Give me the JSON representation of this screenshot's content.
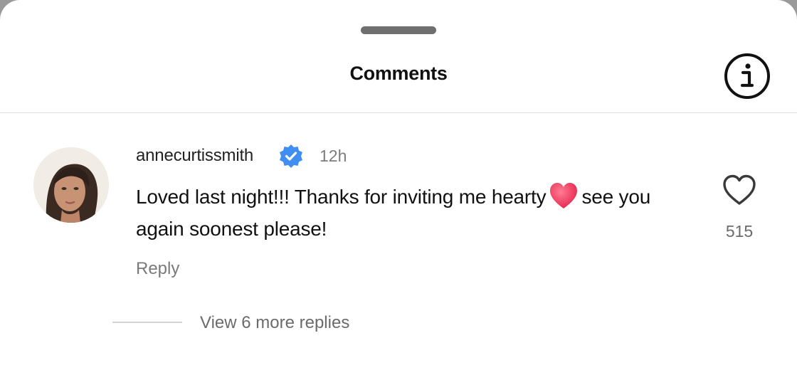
{
  "header": {
    "title": "Comments",
    "info_icon": "info-circle-icon"
  },
  "comment": {
    "username": "annecurtissmith",
    "verified_icon": "verified-badge-icon",
    "timestamp": "12h",
    "text_before_emoji": "Loved last night!!! Thanks for inviting me hearty",
    "emoji": "red-heart-emoji",
    "text_after_emoji": "see you again soonest please!",
    "reply_label": "Reply",
    "like_icon": "heart-outline-icon",
    "like_count": "515"
  },
  "replies": {
    "view_more_label": "View 6 more replies"
  },
  "colors": {
    "verified_blue": "#3f8ef0",
    "heart_red": "#ef3f5e",
    "muted_text": "#7a7a7a"
  }
}
